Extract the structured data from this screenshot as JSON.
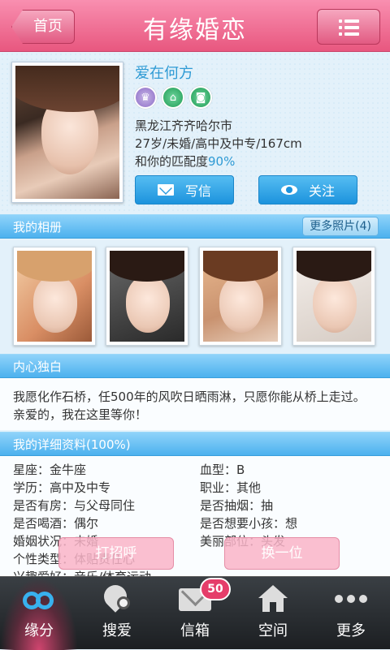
{
  "header": {
    "title": "有缘婚恋",
    "back_label": "首页",
    "menu_icon": "list-menu-icon"
  },
  "profile": {
    "nickname": "爱在何方",
    "badges": [
      "crown-icon",
      "house-icon",
      "car-icon"
    ],
    "location": "黑龙江齐齐哈尔市",
    "basic": "27岁/未婚/高中及中专/167cm",
    "match_prefix": "和你的匹配度",
    "match_value": "90%",
    "write_label": "写信",
    "follow_label": "关注"
  },
  "album": {
    "title": "我的相册",
    "more_label": "更多照片(4)",
    "photo_count": 4
  },
  "monologue": {
    "title": "内心独白",
    "text": "我愿化作石桥，任500年的风吹日晒雨淋，只愿你能从桥上走过。亲爱的，我在这里等你！"
  },
  "details": {
    "title": "我的详细资料(100%)",
    "items": [
      "星座：金牛座",
      "血型：B",
      "学历：高中及中专",
      "职业：其他",
      "是否有房：与父母同住",
      "是否抽烟：抽",
      "是否喝酒：偶尔",
      "是否想要小孩：想",
      "婚姻状况：未婚",
      "美丽部位：头发",
      "个性类型：体贴责任心",
      "兴趣爱好：音乐/体育运动"
    ]
  },
  "floating": {
    "greet_label": "打招呼",
    "next_label": "换一位"
  },
  "tabbar": {
    "tabs": [
      {
        "label": "缘分",
        "icon": "gender-icon"
      },
      {
        "label": "搜爱",
        "icon": "heart-search-icon"
      },
      {
        "label": "信箱",
        "icon": "mail-icon"
      },
      {
        "label": "空间",
        "icon": "home-icon"
      },
      {
        "label": "更多",
        "icon": "more-dots-icon"
      }
    ],
    "mail_count": "50"
  },
  "colors": {
    "header_pink": "#e8577f",
    "accent_blue": "#2e9ad4",
    "section_blue": "#4cb1ee"
  }
}
